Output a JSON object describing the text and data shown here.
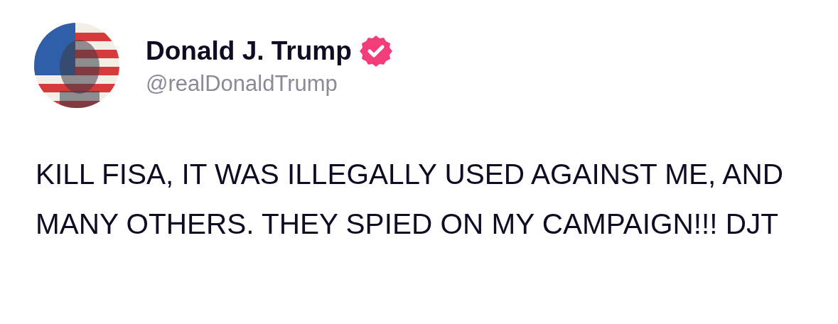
{
  "post": {
    "author": {
      "name": "Donald J. Trump",
      "verified": true,
      "handle": "@realDonaldTrump"
    },
    "text": "KILL FISA, IT WAS ILLEGALLY USED AGAINST ME, AND MANY OTHERS. THEY SPIED ON MY CAMPAIGN!!! DJT"
  }
}
